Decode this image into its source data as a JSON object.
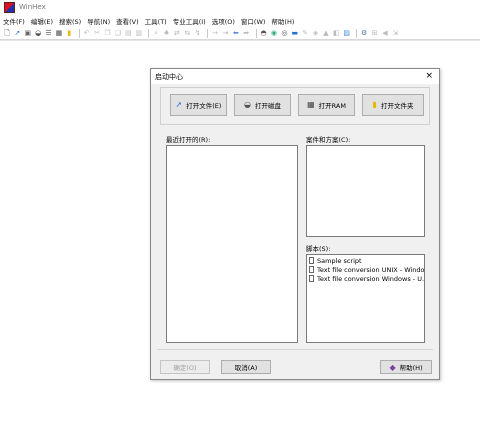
{
  "window": {
    "title": "WinHex"
  },
  "menu": [
    "文件(F)",
    "编辑(E)",
    "搜索(S)",
    "导航(N)",
    "查看(V)",
    "工具(T)",
    "专业工具(I)",
    "选项(O)",
    "窗口(W)",
    "帮助(H)"
  ],
  "toolbar": {
    "icons": [
      {
        "name": "new-file-icon",
        "glyph": "🗋",
        "color": "#444"
      },
      {
        "name": "open-file-icon",
        "glyph": "➚",
        "color": "#2a6fd6"
      },
      {
        "name": "save-icon",
        "glyph": "▣",
        "color": "#666"
      },
      {
        "name": "disk-icon",
        "glyph": "◒",
        "color": "#555"
      },
      {
        "name": "properties-icon",
        "glyph": "☰",
        "color": "#666"
      },
      {
        "name": "ram-icon",
        "glyph": "▦",
        "color": "#444"
      },
      {
        "name": "folder-icon",
        "glyph": "▮",
        "color": "#e6b800"
      },
      {
        "sep": true
      },
      {
        "name": "undo-icon",
        "glyph": "↶",
        "color": "#bbb"
      },
      {
        "name": "cut-icon",
        "glyph": "✂",
        "color": "#bbb"
      },
      {
        "name": "copy-icon",
        "glyph": "❐",
        "color": "#bbb"
      },
      {
        "name": "paste-icon",
        "glyph": "❏",
        "color": "#bbb"
      },
      {
        "name": "copy-block-icon",
        "glyph": "▤",
        "color": "#bbb"
      },
      {
        "name": "write-icon",
        "glyph": "▥",
        "color": "#bbb"
      },
      {
        "sep": true
      },
      {
        "name": "find-icon",
        "glyph": "⌕",
        "color": "#bbb"
      },
      {
        "name": "find-hex-icon",
        "glyph": "♠",
        "color": "#bbb"
      },
      {
        "name": "replace-icon",
        "glyph": "⇄",
        "color": "#bbb"
      },
      {
        "name": "replace-hex-icon",
        "glyph": "⇆",
        "color": "#bbb"
      },
      {
        "name": "find-next-icon",
        "glyph": "↯",
        "color": "#bbb"
      },
      {
        "sep": true
      },
      {
        "name": "goto-offset-icon",
        "glyph": "→",
        "color": "#bbb"
      },
      {
        "name": "goto-sector-icon",
        "glyph": "⇥",
        "color": "#bbb"
      },
      {
        "name": "back-icon",
        "glyph": "⬅",
        "color": "#5b8fd9"
      },
      {
        "name": "forward-icon",
        "glyph": "➡",
        "color": "#bbb"
      },
      {
        "sep": true
      },
      {
        "name": "disk-editor-icon",
        "glyph": "◓",
        "color": "#555"
      },
      {
        "name": "clone-disk-icon",
        "glyph": "◉",
        "color": "#3a7"
      },
      {
        "name": "image-disk-icon",
        "glyph": "◎",
        "color": "#555"
      },
      {
        "name": "calculator-icon",
        "glyph": "▬",
        "color": "#2a6fd6"
      },
      {
        "name": "hash-icon",
        "glyph": "✎",
        "color": "#bbb"
      },
      {
        "name": "template-icon",
        "glyph": "◈",
        "color": "#bbb"
      },
      {
        "name": "analyze-icon",
        "glyph": "▲",
        "color": "#bbb"
      },
      {
        "name": "compare-icon",
        "glyph": "◧",
        "color": "#bbb"
      },
      {
        "name": "checksum-icon",
        "glyph": "▨",
        "color": "#4a8fd9"
      },
      {
        "sep": true
      },
      {
        "name": "options-icon",
        "glyph": "⚙",
        "color": "#5577aa"
      },
      {
        "name": "view-icon",
        "glyph": "⊞",
        "color": "#bbb"
      },
      {
        "name": "nav-left-icon",
        "glyph": "◀",
        "color": "#bbb"
      },
      {
        "name": "nav-right-icon",
        "glyph": "⇲",
        "color": "#bbb"
      }
    ]
  },
  "dialog": {
    "title": "启动中心",
    "close_glyph": "×",
    "buttons": [
      {
        "name": "open-file-button",
        "icon_name": "open-file-icon",
        "icon": "➚",
        "icon_color": "#2a6fd6",
        "label": "打开文件(E)"
      },
      {
        "name": "open-disk-button",
        "icon_name": "disk-icon",
        "icon": "◒",
        "icon_color": "#555",
        "label": "打开磁盘"
      },
      {
        "name": "open-ram-button",
        "icon_name": "ram-icon",
        "icon": "▦",
        "icon_color": "#444",
        "label": "打开RAM"
      },
      {
        "name": "open-folder-button",
        "icon_name": "folder-icon",
        "icon": "▮",
        "icon_color": "#e6b800",
        "label": "打开文件夹"
      }
    ],
    "recent_label": "最近打开的(R):",
    "cases_label": "案件和方案(C):",
    "scripts_label": "脚本(S):",
    "scripts": [
      "Sample script",
      "Text file conversion UNIX - Windo...",
      "Text file conversion Windows - U..."
    ],
    "open_button": "确定(O)",
    "cancel_button": "取消(A)",
    "help_button": "帮助(H)",
    "help_icon_color": "#7a3fa0"
  }
}
